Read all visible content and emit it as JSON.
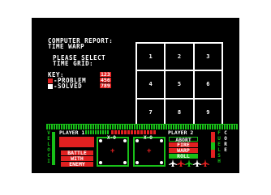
{
  "report": {
    "line1": "COMPUTER REPORT:",
    "line2": "TIME WARP",
    "prompt1": "PLEASE SELECT",
    "prompt2": "TIME GRID:",
    "key_label": "KEY:",
    "key_items": [
      {
        "label": "-PROBLEM",
        "value": "456",
        "color": "#e02020"
      },
      {
        "label": "-SOLVED",
        "value": "789",
        "color": "#ffffff"
      }
    ],
    "key_value_top": "123"
  },
  "time_grid": {
    "cells": [
      "1",
      "2",
      "3",
      "4",
      "5",
      "6",
      "7",
      "8",
      "9"
    ]
  },
  "console": {
    "player1_label": "PLAYER 1",
    "player2_label": "PLAYER 2",
    "left_column": [
      "V",
      "E",
      "L",
      "O",
      "C",
      "I",
      "T",
      "Y"
    ],
    "right_column_a": [
      "F",
      "U",
      "E",
      "L",
      "S",
      "H",
      "I",
      "P"
    ],
    "right_column_b": [
      "C",
      "O",
      "R",
      "E"
    ],
    "left_panel_text": [
      "BATTLE",
      "WITH",
      "ENEMY"
    ],
    "center_left_glyph": "+",
    "center_right_glyph": "+",
    "panel_labels": [
      "X-O",
      "X-O"
    ],
    "right_menu": {
      "item1": "FIRE",
      "item2": "WARP",
      "item3": "ROLL",
      "item4": "ABORT"
    },
    "ships": [
      "white",
      "red",
      "green",
      "white",
      "red"
    ]
  },
  "colors": {
    "screen_bg": "#000000",
    "text": "#ffffff",
    "accent_red": "#e02020",
    "accent_green": "#18c018",
    "border_bg": "#ffffff"
  }
}
